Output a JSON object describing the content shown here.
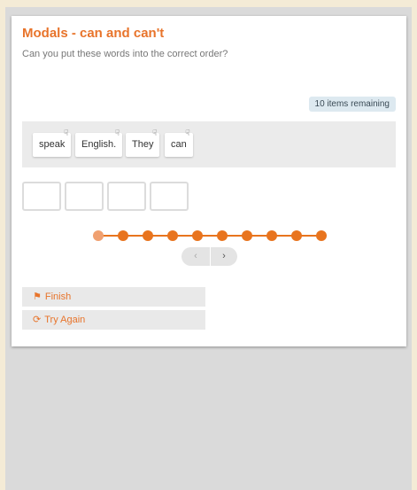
{
  "activity": {
    "title": "Modals - can and can't",
    "instruction": "Can you put these words into the correct order?",
    "remaining_label": "10 items remaining"
  },
  "words": [
    "speak",
    "English.",
    "They",
    "can"
  ],
  "slots_count": 4,
  "progress": {
    "total": 10,
    "current": 1
  },
  "nav": {
    "prev_icon": "chevron-left-icon",
    "next_icon": "chevron-right-icon",
    "prev_glyph": "‹",
    "next_glyph": "›"
  },
  "actions": {
    "finish_label": "Finish",
    "finish_icon": "flag-icon",
    "try_again_label": "Try Again",
    "try_again_icon": "refresh-icon"
  },
  "colors": {
    "accent": "#e8742b",
    "background": "#f4ebd6",
    "panel": "#dadada"
  }
}
